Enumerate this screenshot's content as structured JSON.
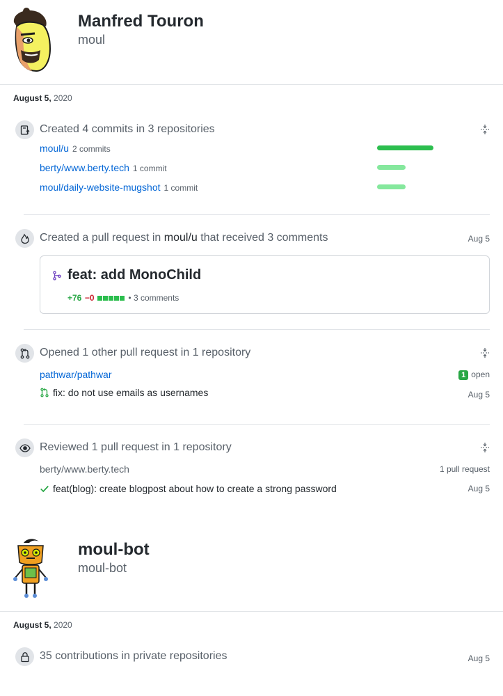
{
  "user1": {
    "name": "Manfred Touron",
    "login": "moul"
  },
  "day1": {
    "date_bold": "August 5,",
    "year": "2020"
  },
  "commits_event": {
    "summary": "Created 4 commits in 3 repositories",
    "repos": [
      {
        "name": "moul/u",
        "count": "2 commits",
        "fraction": 1.0
      },
      {
        "name": "berty/www.berty.tech",
        "count": "1 commit",
        "fraction": 0.5
      },
      {
        "name": "moul/daily-website-mugshot",
        "count": "1 commit",
        "fraction": 0.5
      }
    ]
  },
  "pr_event": {
    "summary_prefix": "Created a pull request in",
    "repo": "moul/u",
    "summary_suffix": "that received 3 comments",
    "date": "Aug 5",
    "pr_title": "feat: add MonoChild",
    "additions": "+76",
    "deletions": "−0",
    "comments": "• 3 comments",
    "diffstat_blocks": 5
  },
  "opened_event": {
    "summary": "Opened 1 other pull request in 1 repository",
    "repo": "pathwar/pathwar",
    "badge": "1",
    "badge_label": "open",
    "pr_title": "fix: do not use emails as usernames",
    "date": "Aug 5"
  },
  "reviewed_event": {
    "summary": "Reviewed 1 pull request in 1 repository",
    "repo": "berty/www.berty.tech",
    "count_label": "1 pull request",
    "pr_title": "feat(blog): create blogpost about how to create a strong password",
    "date": "Aug 5"
  },
  "user2": {
    "name": "moul-bot",
    "login": "moul-bot"
  },
  "day2": {
    "date_bold": "August 5,",
    "year": "2020"
  },
  "private_event": {
    "summary": "35 contributions in private repositories",
    "date": "Aug 5"
  },
  "colors": {
    "link": "#0366d6",
    "green": "#2cbe4e",
    "light_green": "#85e89d",
    "purple": "#6f42c1"
  }
}
